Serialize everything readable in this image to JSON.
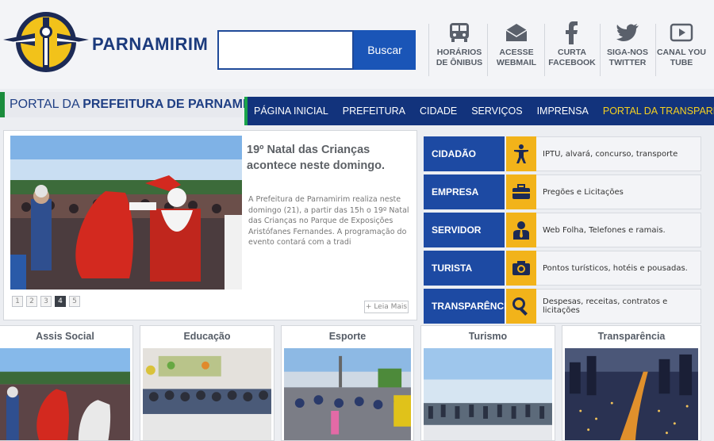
{
  "header": {
    "site_name": "PARNAMIRIM",
    "search_button": "Buscar",
    "quick_links": [
      {
        "icon": "bus-icon",
        "label": "HORÁRIOS DE ÔNIBUS"
      },
      {
        "icon": "envelope-icon",
        "label": "ACESSE WEBMAIL"
      },
      {
        "icon": "facebook-icon",
        "label": "CURTA FACEBOOK"
      },
      {
        "icon": "twitter-icon",
        "label": "SIGA-NOS TWITTER"
      },
      {
        "icon": "youtube-icon",
        "label": "CANAL YOU TUBE"
      }
    ]
  },
  "portal": {
    "prefix": "PORTAL DA ",
    "bold": "PREFEITURA DE PARNAMIRIM"
  },
  "nav": {
    "items": [
      "PÁGINA INICIAL",
      "PREFEITURA",
      "CIDADE",
      "SERVIÇOS",
      "IMPRENSA",
      "PORTAL DA TRANSPARÊNCIA"
    ]
  },
  "news": {
    "title": "19º Natal das Crianças acontece neste domingo.",
    "text": "A Prefeitura de Parnamirim realiza neste domingo (21), a partir das 15h o 19º Natal das Crianças no Parque de Exposições Aristófanes Fernandes. A programação do evento contará com a tradi",
    "pages": [
      "1",
      "2",
      "3",
      "4",
      "5"
    ],
    "active_page": "4",
    "read_more": "+ Leia Mais"
  },
  "services": [
    {
      "label": "CIDADÃO",
      "icon": "person-icon",
      "desc": "IPTU, alvará, concurso, transporte"
    },
    {
      "label": "EMPRESA",
      "icon": "briefcase-icon",
      "desc": "Pregões e Licitações"
    },
    {
      "label": "SERVIDOR",
      "icon": "employee-icon",
      "desc": "Web Folha, Telefones e ramais."
    },
    {
      "label": "TURISTA",
      "icon": "camera-icon",
      "desc": "Pontos turísticos, hotéis e pousadas."
    },
    {
      "label": "TRANSPARÊNCIA",
      "icon": "magnifier-icon",
      "desc": "Despesas, receitas, contratos e licitações"
    }
  ],
  "categories": [
    {
      "title": "Assis Social"
    },
    {
      "title": "Educação"
    },
    {
      "title": "Esporte"
    },
    {
      "title": "Turismo"
    },
    {
      "title": "Transparência"
    }
  ],
  "colors": {
    "primary_blue": "#1d4aa3",
    "nav_blue": "#12337c",
    "accent_yellow": "#f2b31a",
    "accent_green": "#19a44a"
  }
}
